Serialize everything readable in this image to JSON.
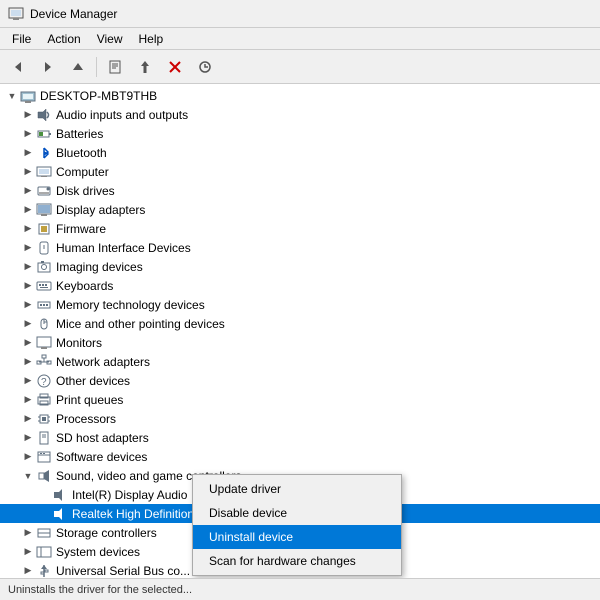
{
  "titleBar": {
    "title": "Device Manager",
    "icon": "device-manager-icon"
  },
  "menuBar": {
    "items": [
      "File",
      "Action",
      "View",
      "Help"
    ]
  },
  "toolbar": {
    "buttons": [
      {
        "name": "back",
        "icon": "◀",
        "label": "Back"
      },
      {
        "name": "forward",
        "icon": "▶",
        "label": "Forward"
      },
      {
        "name": "up",
        "icon": "▲",
        "label": "Up"
      },
      {
        "name": "properties",
        "icon": "⊞",
        "label": "Properties"
      },
      {
        "name": "update-driver",
        "icon": "↑",
        "label": "Update driver"
      },
      {
        "name": "uninstall",
        "icon": "✕",
        "label": "Uninstall device"
      },
      {
        "name": "scan",
        "icon": "↻",
        "label": "Scan for hardware changes"
      }
    ]
  },
  "tree": {
    "root": {
      "label": "DESKTOP-MBT9THB",
      "depth": 0,
      "expanded": true,
      "icon": "computer"
    },
    "items": [
      {
        "label": "Audio inputs and outputs",
        "depth": 1,
        "icon": "audio",
        "expanded": false
      },
      {
        "label": "Batteries",
        "depth": 1,
        "icon": "battery",
        "expanded": false
      },
      {
        "label": "Bluetooth",
        "depth": 1,
        "icon": "bluetooth",
        "expanded": false
      },
      {
        "label": "Computer",
        "depth": 1,
        "icon": "computer-sm",
        "expanded": false
      },
      {
        "label": "Disk drives",
        "depth": 1,
        "icon": "disk",
        "expanded": false
      },
      {
        "label": "Display adapters",
        "depth": 1,
        "icon": "display",
        "expanded": false
      },
      {
        "label": "Firmware",
        "depth": 1,
        "icon": "firmware",
        "expanded": false
      },
      {
        "label": "Human Interface Devices",
        "depth": 1,
        "icon": "hid",
        "expanded": false
      },
      {
        "label": "Imaging devices",
        "depth": 1,
        "icon": "imaging",
        "expanded": false
      },
      {
        "label": "Keyboards",
        "depth": 1,
        "icon": "keyboard",
        "expanded": false
      },
      {
        "label": "Memory technology devices",
        "depth": 1,
        "icon": "memory",
        "expanded": false
      },
      {
        "label": "Mice and other pointing devices",
        "depth": 1,
        "icon": "mouse",
        "expanded": false
      },
      {
        "label": "Monitors",
        "depth": 1,
        "icon": "monitor",
        "expanded": false
      },
      {
        "label": "Network adapters",
        "depth": 1,
        "icon": "network",
        "expanded": false
      },
      {
        "label": "Other devices",
        "depth": 1,
        "icon": "other",
        "expanded": false
      },
      {
        "label": "Print queues",
        "depth": 1,
        "icon": "print",
        "expanded": false
      },
      {
        "label": "Processors",
        "depth": 1,
        "icon": "cpu",
        "expanded": false
      },
      {
        "label": "SD host adapters",
        "depth": 1,
        "icon": "sd",
        "expanded": false
      },
      {
        "label": "Software devices",
        "depth": 1,
        "icon": "software",
        "expanded": false
      },
      {
        "label": "Sound, video and game controllers",
        "depth": 1,
        "icon": "sound",
        "expanded": true
      },
      {
        "label": "Intel(R) Display Audio",
        "depth": 2,
        "icon": "audio-device",
        "expanded": false
      },
      {
        "label": "Realtek High Definition Audio",
        "depth": 2,
        "icon": "audio-device",
        "expanded": false,
        "selected": true
      },
      {
        "label": "Storage controllers",
        "depth": 1,
        "icon": "storage",
        "expanded": false
      },
      {
        "label": "System devices",
        "depth": 1,
        "icon": "system",
        "expanded": false
      },
      {
        "label": "Universal Serial Bus co...",
        "depth": 1,
        "icon": "usb",
        "expanded": false
      }
    ]
  },
  "contextMenu": {
    "items": [
      {
        "label": "Update driver",
        "highlighted": false
      },
      {
        "label": "Disable device",
        "highlighted": false
      },
      {
        "label": "Uninstall device",
        "highlighted": true
      },
      {
        "label": "Scan for hardware changes",
        "highlighted": false
      }
    ]
  },
  "statusBar": {
    "text": "Uninstalls the driver for the selected..."
  }
}
